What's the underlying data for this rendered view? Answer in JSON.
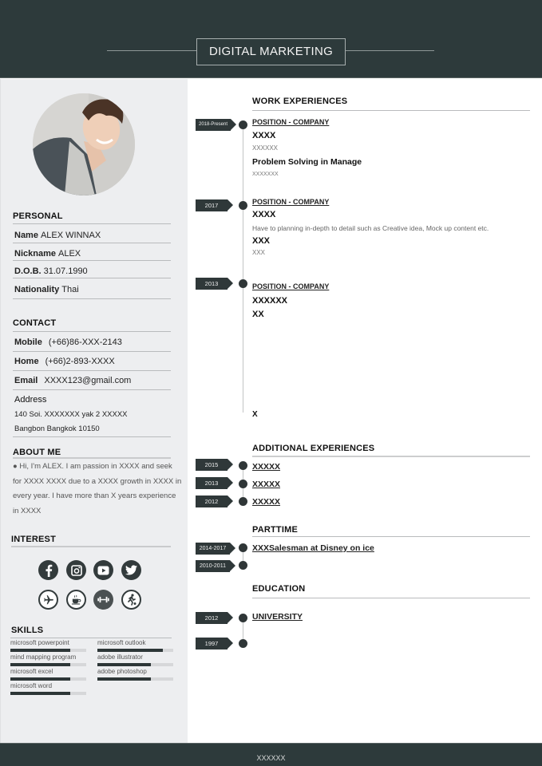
{
  "header": {
    "title": "DIGITAL MARKETING"
  },
  "personal": {
    "title": "PERSONAL",
    "fields": [
      {
        "label": "Name",
        "value": "ALEX WINNAX"
      },
      {
        "label": "Nickname",
        "value": "ALEX"
      },
      {
        "label": "D.O.B.",
        "value": "31.07.1990"
      },
      {
        "label": "Nationality",
        "value": "Thai"
      }
    ]
  },
  "contact": {
    "title": "CONTACT",
    "fields": [
      {
        "label": "Mobile",
        "value": "(+66)86-XXX-2143"
      },
      {
        "label": "Home",
        "value": "(+66)2-893-XXXX"
      },
      {
        "label": "Email",
        "value": "XXXX123@gmail.com"
      }
    ],
    "address_label": "Address",
    "address_lines": [
      "140 Soi. XXXXXXX yak 2 XXXXX",
      "Bangbon Bangkok 10150"
    ]
  },
  "about": {
    "title": "ABOUT ME",
    "text": "● Hi, I'm ALEX. I am passion in XXXX and seek for XXXX XXXX due to a XXXX growth in XXXX in every year. I have more than X years experience in XXXX"
  },
  "interest": {
    "title": "INTEREST",
    "icons": [
      "facebook-icon",
      "instagram-icon",
      "youtube-icon",
      "twitter-icon",
      "airplane-icon",
      "coffee-icon",
      "dumbbell-icon",
      "football-icon"
    ]
  },
  "skills": {
    "title": "SKILLS",
    "items": [
      {
        "name": "microsoft powerpoint",
        "level": 0.79
      },
      {
        "name": "mind mapping program",
        "level": 0.79
      },
      {
        "name": "microsoft excel",
        "level": 0.79
      },
      {
        "name": "microsoft word",
        "level": 0.79
      },
      {
        "name": "microsoft outlook",
        "level": 0.86
      },
      {
        "name": "adobe illustrator",
        "level": 0.7
      },
      {
        "name": "adobe photoshop",
        "level": 0.7
      }
    ]
  },
  "work": {
    "title": "WORK EXPERIENCES",
    "entries": [
      {
        "period": "2018-Present",
        "position": "POSITION - COMPANY",
        "role": "XXXX",
        "detail": "XXXXXX",
        "subtitle": "Problem Solving in Manage",
        "subdetail": "XXXXXXX"
      },
      {
        "period": "2017",
        "position": "POSITION - COMPANY",
        "role": "XXXX",
        "detail": "Have to planning in-depth to detail such as Creative idea, Mock up content etc.",
        "subtitle": "XXX",
        "subdetail": "XXX"
      },
      {
        "period": "2013",
        "position": "POSITION - COMPANY",
        "role": "XXXXXX",
        "detail": "XX",
        "footnote": "X"
      }
    ]
  },
  "additional": {
    "title": "ADDITIONAL EXPERIENCES",
    "entries": [
      {
        "period": "2015",
        "text": "XXXXX"
      },
      {
        "period": "2013",
        "text": "XXXXX"
      },
      {
        "period": "2012",
        "text": "XXXXX"
      }
    ]
  },
  "parttime": {
    "title": "PARTTIME",
    "entries": [
      {
        "period": "2014-2017",
        "text": "XXXSalesman at Disney on ice"
      },
      {
        "period": "2010-2011",
        "text": ""
      }
    ]
  },
  "education": {
    "title": "EDUCATION",
    "entries": [
      {
        "period": "2012",
        "text": "UNIVERSITY"
      },
      {
        "period": "1997",
        "text": ""
      }
    ]
  },
  "footer": {
    "text": "XXXXXX"
  }
}
